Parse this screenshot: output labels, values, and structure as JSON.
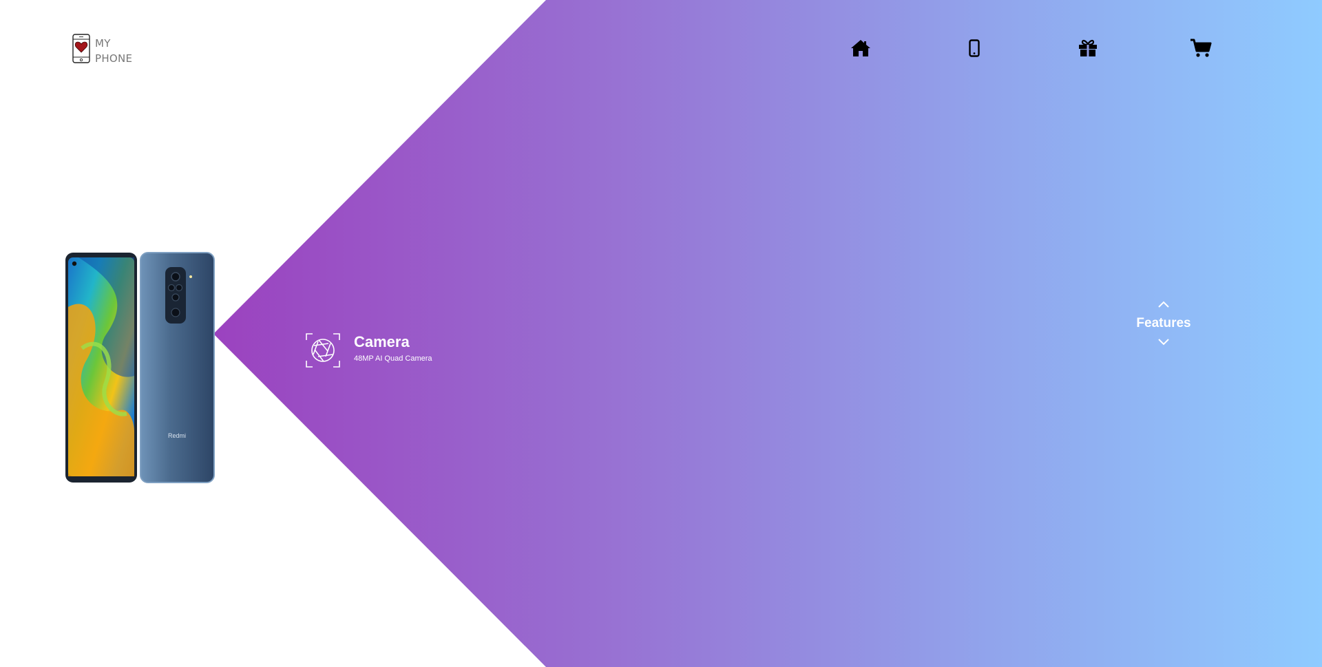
{
  "logo": {
    "line1": "MY",
    "line2": "PHONE",
    "icon": "phone-heart-icon"
  },
  "nav": {
    "items": [
      {
        "name": "home",
        "icon": "home-icon"
      },
      {
        "name": "phones",
        "icon": "mobile-phone-icon"
      },
      {
        "name": "gifts",
        "icon": "gift-icon"
      },
      {
        "name": "cart",
        "icon": "shopping-cart-icon"
      }
    ]
  },
  "product": {
    "brand_mark": "Redmi"
  },
  "feature": {
    "icon": "camera-aperture-icon",
    "title": "Camera",
    "subtitle": "48MP AI Quad Camera"
  },
  "switcher": {
    "label": "Features",
    "up_icon": "chevron-up-icon",
    "down_icon": "chevron-down-icon"
  },
  "colors": {
    "gradient_start": "#9b4bc0",
    "gradient_end": "#8fcbff",
    "text_light": "#ffffff",
    "icon_dark": "#000000"
  }
}
